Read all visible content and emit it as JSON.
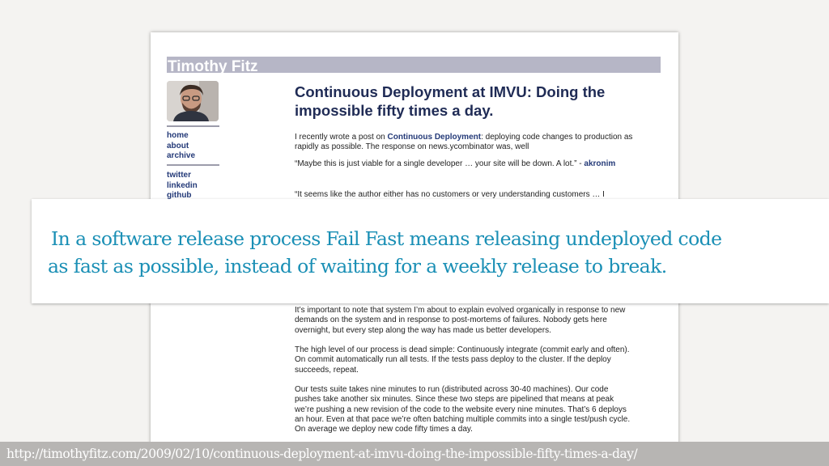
{
  "blog": {
    "name": "Timothy Fitz",
    "nav_primary": [
      "home",
      "about",
      "archive"
    ],
    "nav_social": [
      "twitter",
      "linkedin",
      "github"
    ]
  },
  "post": {
    "title": "Continuous Deployment at IMVU: Doing the impossible fifty times a day.",
    "intro_before": "I recently wrote a post on ",
    "intro_link": "Continuous Deployment",
    "intro_after": ": deploying code changes to production as rapidly as possible. The response on news.ycombinator was, well",
    "quote1_text": "“Maybe this is just viable for a single developer … your site will be down. A lot.” -",
    "quote1_author": "akronim",
    "quote2_text": "“It seems like the author either has no customers or very understanding customers … I",
    "para_evolved": "It’s important to note that system I’m about to explain evolved organically in response to new demands on the system and in response to post-mortems of failures. Nobody gets here overnight, but every step along the way has made us better developers.",
    "para_process": "The high level of our process is dead simple: Continuously integrate (commit early and often). On commit automatically run all tests. If the tests pass deploy to the cluster. If the deploy succeeds, repeat.",
    "para_tests": "Our tests suite takes nine minutes to run (distributed across 30-40 machines). Our code pushes take another six minutes. Since these two steps are pipelined that means at peak we’re pushing a new revision of the code to the website every nine minutes. That’s 6 deploys an hour. Even at that pace we’re often batching multiple commits into a single test/push cycle. On average we deploy new code fifty times a day."
  },
  "slide": {
    "caption_line1": "In a software release process Fail Fast means releasing undeployed code",
    "caption_line2": "as fast as possible, instead of waiting for a weekly release to break.",
    "source_url": "http://timothyfitz.com/2009/02/10/continuous-deployment-at-imvu-doing-the-impossible-fifty-times-a-day/"
  },
  "colors": {
    "caption": "#1a8fb5",
    "blog_link": "#243a78",
    "header_bar": "#b6b6c6",
    "url_bar": "#b7b5b3"
  }
}
